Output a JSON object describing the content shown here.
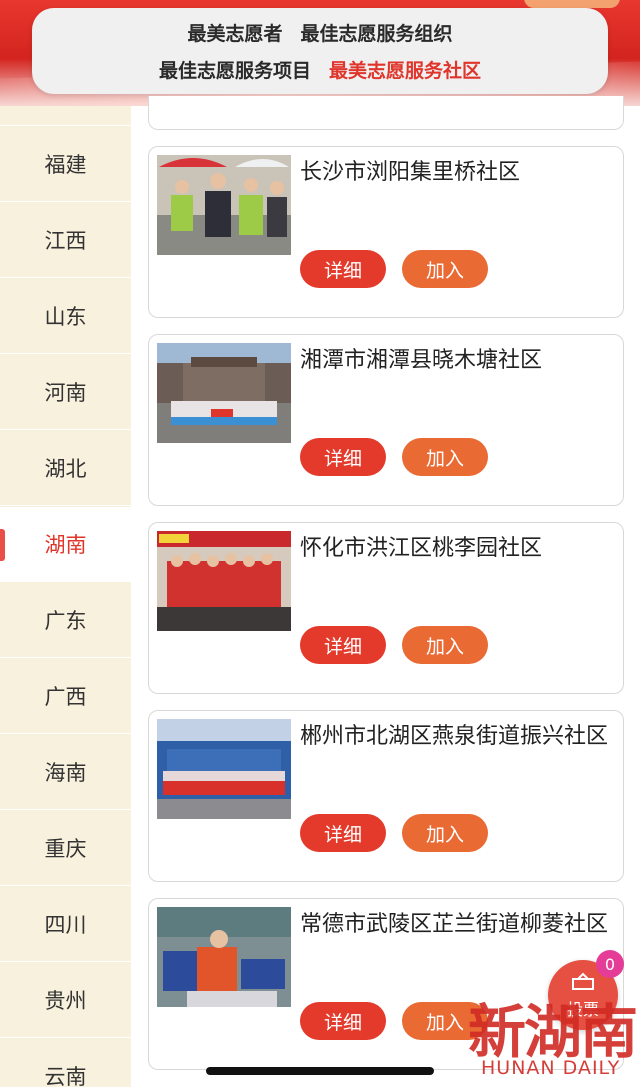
{
  "tabs": {
    "row1": [
      "最美志愿者",
      "最佳志愿服务组织"
    ],
    "row2": [
      "最佳志愿服务项目",
      "最美志愿服务社区"
    ],
    "active": "最美志愿服务社区"
  },
  "sidebar": {
    "items": [
      "福建",
      "江西",
      "山东",
      "河南",
      "湖北",
      "湖南",
      "广东",
      "广西",
      "海南",
      "重庆",
      "四川",
      "贵州",
      "云南"
    ],
    "active": "湖南"
  },
  "cards": [
    {
      "title": "长沙市浏阳集里桥社区",
      "detail_label": "详细",
      "join_label": "加入"
    },
    {
      "title": "湘潭市湘潭县晓木塘社区",
      "detail_label": "详细",
      "join_label": "加入"
    },
    {
      "title": "怀化市洪江区桃李园社区",
      "detail_label": "详细",
      "join_label": "加入"
    },
    {
      "title": "郴州市北湖区燕泉街道振兴社区",
      "detail_label": "详细",
      "join_label": "加入"
    },
    {
      "title": "常德市武陵区芷兰街道柳菱社区",
      "detail_label": "详细",
      "join_label": "加入"
    }
  ],
  "float": {
    "label": "投票",
    "badge_count": "0"
  },
  "watermark": {
    "text": "新湖南",
    "sub": "HUNAN DAILY"
  },
  "colors": {
    "accent": "#e0352b",
    "detail_button": "#e43a2c",
    "join_button": "#ea6a34",
    "sidebar_bg": "#f7f0dc"
  }
}
